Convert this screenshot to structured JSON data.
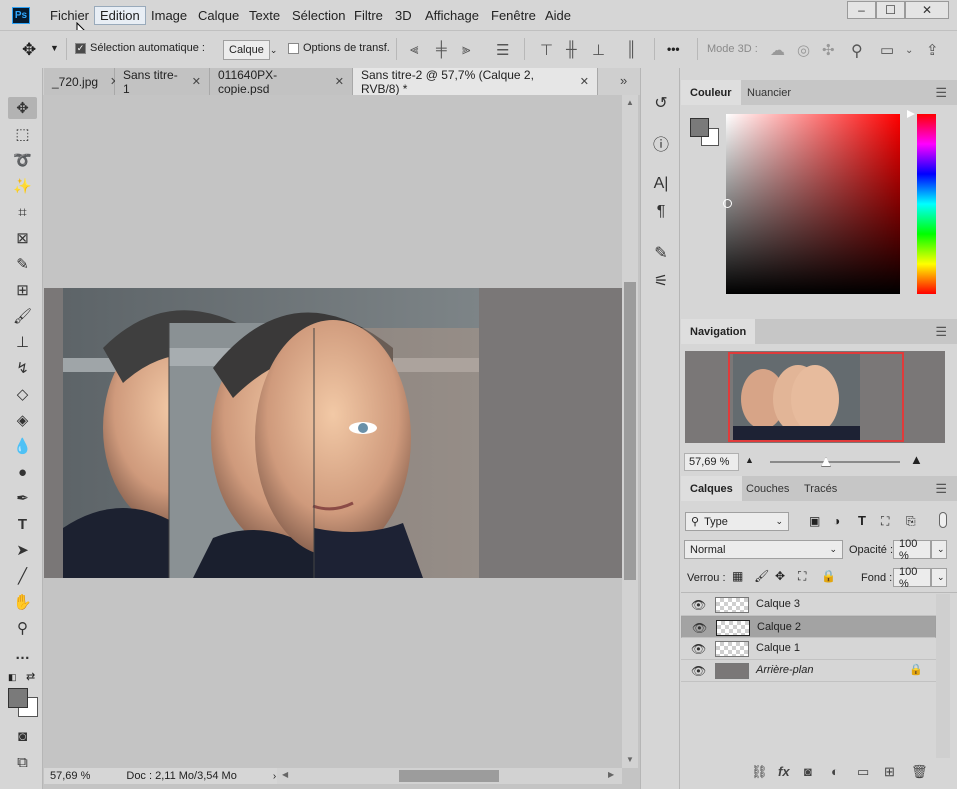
{
  "app": {
    "logo": "Ps"
  },
  "menu": [
    "Fichier",
    "Edition",
    "Image",
    "Calque",
    "Texte",
    "Sélection",
    "Filtre",
    "3D",
    "Affichage",
    "Fenêtre",
    "Aide"
  ],
  "window_buttons": [
    "–",
    "☐",
    "✕"
  ],
  "options": {
    "auto_select_label": "Sélection automatique :",
    "auto_select_checked": true,
    "auto_select_value": "Calque",
    "transform_label": "Options de transf.",
    "mode3d_label": "Mode 3D :",
    "more_label": "•••"
  },
  "tabs": [
    {
      "label": "_720.jpg",
      "close": "✕"
    },
    {
      "label": "Sans titre-1",
      "close": "✕"
    },
    {
      "label": "011640PX-copie.psd",
      "close": "✕"
    },
    {
      "label": "Sans titre-2 @ 57,7% (Calque 2, RVB/8) *",
      "close": "✕"
    }
  ],
  "status": {
    "zoom": "57,69 %",
    "doc": "Doc : 2,11 Mo/3,54 Mo"
  },
  "color_panel": {
    "tabs": [
      "Couleur",
      "Nuancier"
    ],
    "foreground": "#7a7a7a",
    "background": "#ffffff"
  },
  "navigation": {
    "tab": "Navigation",
    "zoom": "57,69 %"
  },
  "layers_panel": {
    "tabs": [
      "Calques",
      "Couches",
      "Tracés"
    ],
    "filter": "Type",
    "blend_mode": "Normal",
    "opacity_label": "Opacité :",
    "opacity": "100 %",
    "lock_label": "Verrou :",
    "fill_label": "Fond :",
    "fill": "100 %",
    "layers": [
      {
        "name": "Calque 3",
        "selected": false
      },
      {
        "name": "Calque 2",
        "selected": true
      },
      {
        "name": "Calque 1",
        "selected": false
      },
      {
        "name": "Arrière-plan",
        "selected": false,
        "locked": true
      }
    ],
    "bottom_icons": [
      "link-icon",
      "fx-icon",
      "mask-icon",
      "adjustment-icon",
      "folder-icon",
      "new-layer-icon",
      "trash-icon"
    ]
  }
}
